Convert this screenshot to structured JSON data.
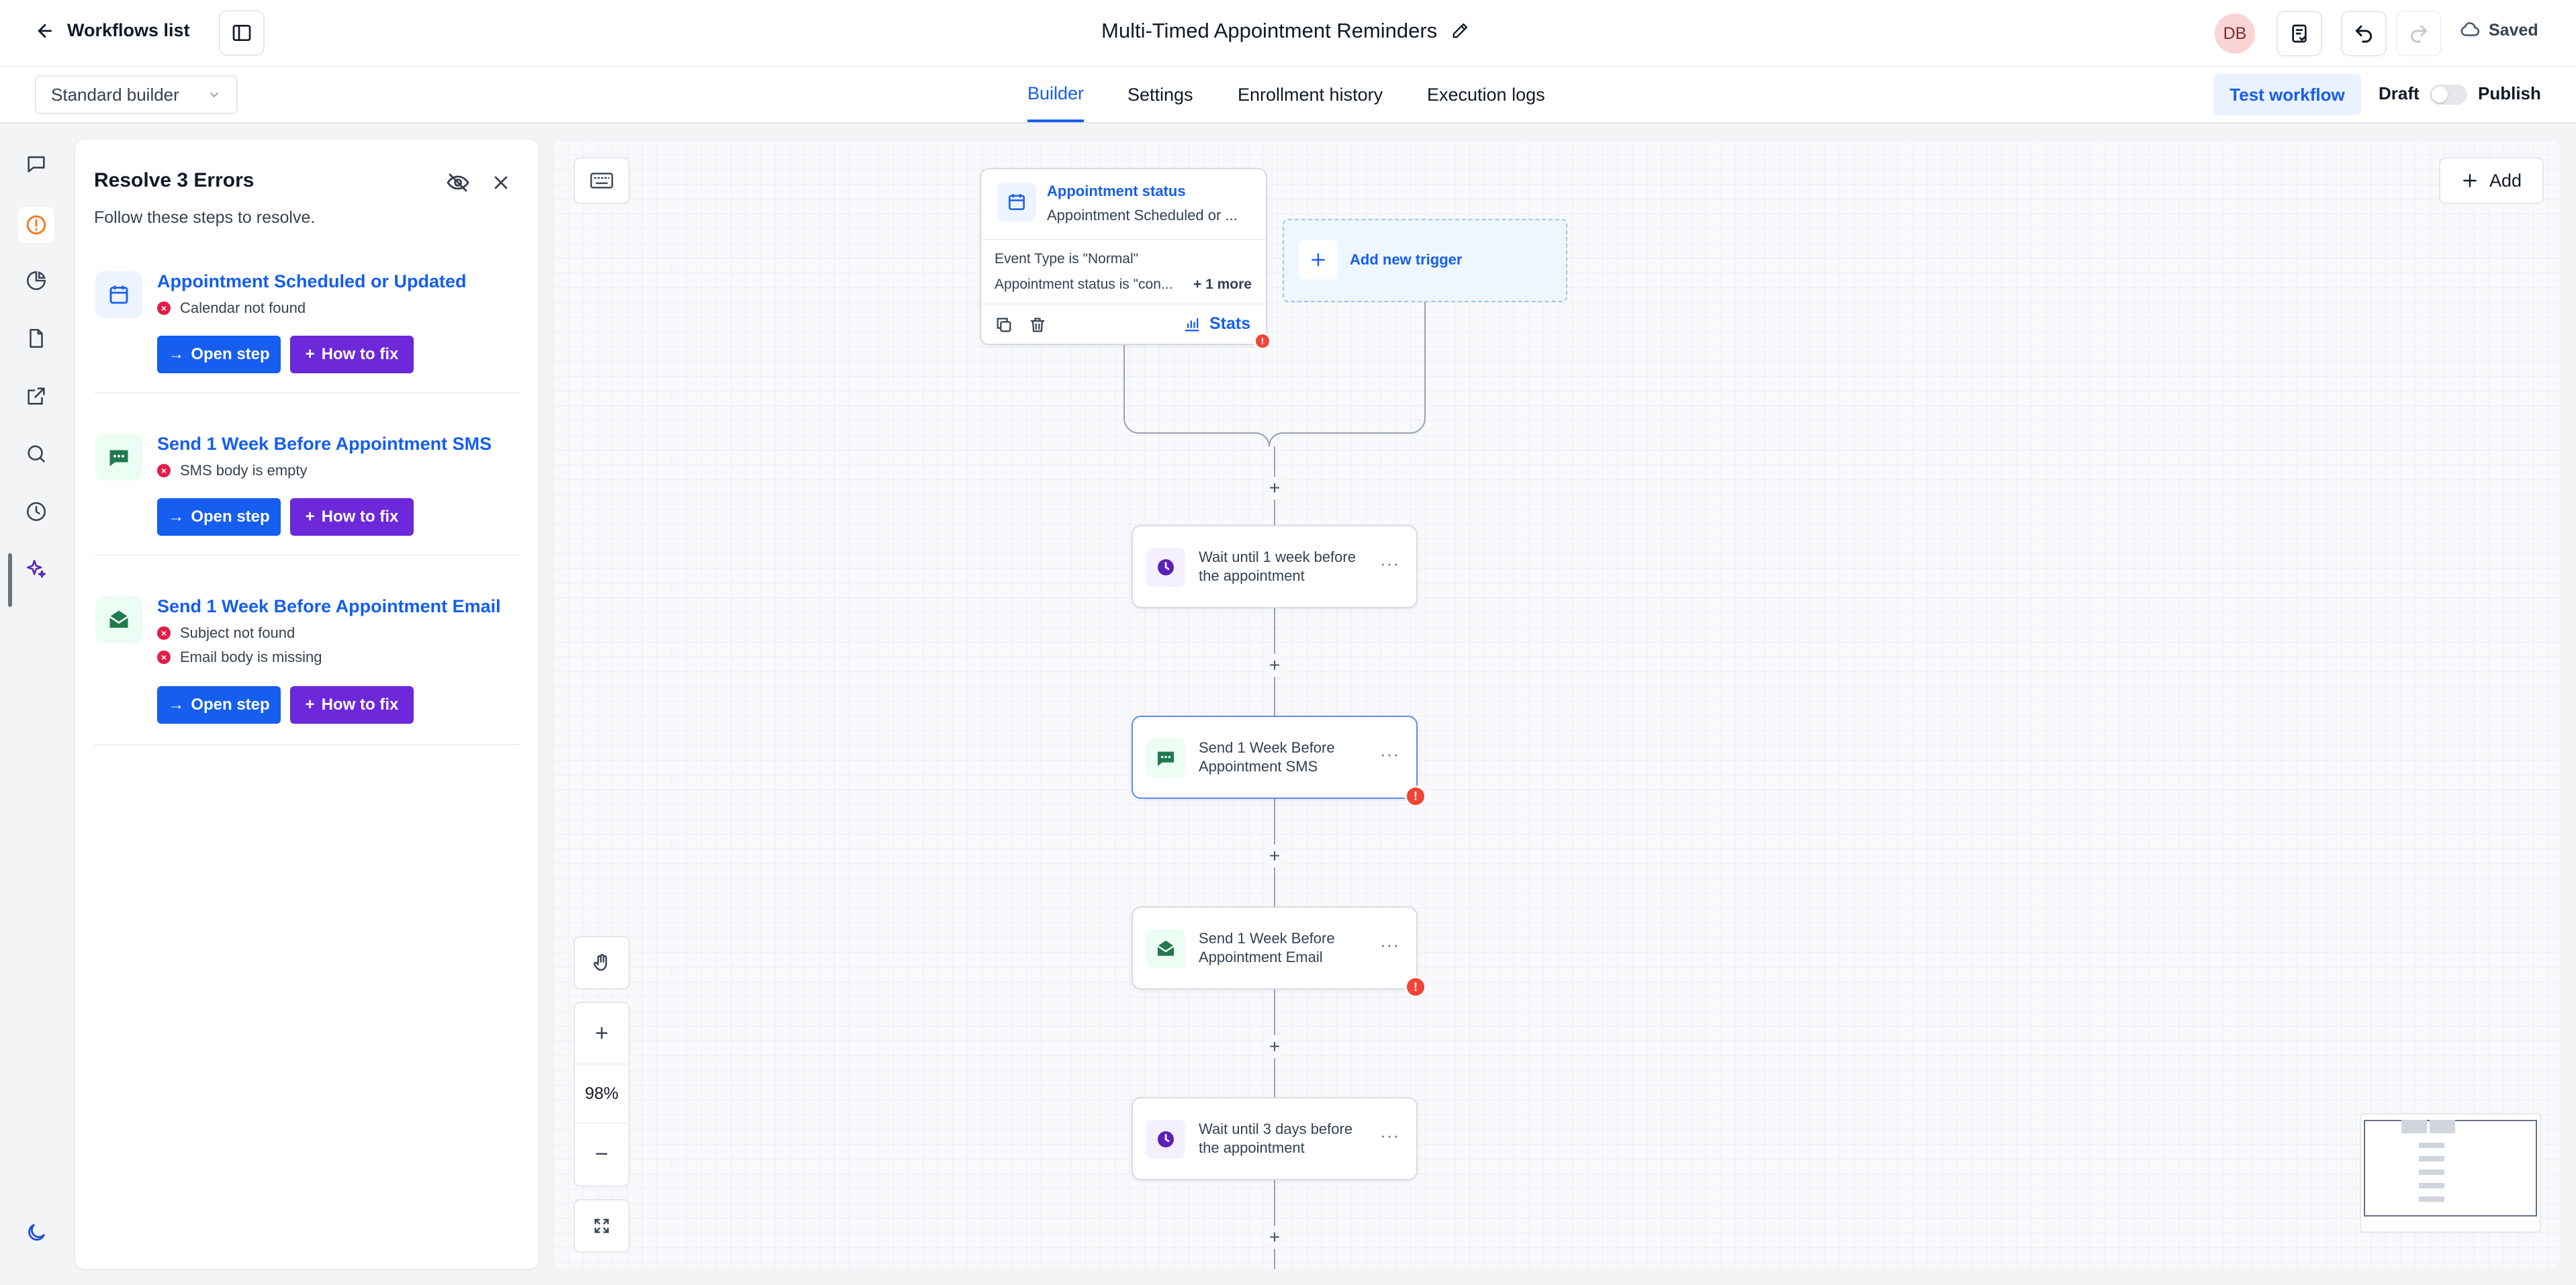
{
  "header": {
    "back_label": "Workflows list",
    "workflow_title": "Multi-Timed Appointment Reminders",
    "avatar_initials": "DB",
    "save_status": "Saved"
  },
  "subbar": {
    "builder_mode": "Standard builder",
    "tabs": [
      {
        "label": "Builder",
        "active": true
      },
      {
        "label": "Settings",
        "active": false
      },
      {
        "label": "Enrollment history",
        "active": false
      },
      {
        "label": "Execution logs",
        "active": false
      }
    ],
    "test_workflow_label": "Test workflow",
    "draft_label": "Draft",
    "publish_label": "Publish",
    "publish_toggle_on": false
  },
  "rail": {
    "icons": [
      "chat-icon",
      "alert-circle-icon",
      "pie-chart-icon",
      "file-icon",
      "external-link-icon",
      "search-icon",
      "history-icon",
      "sparkles-icon",
      "moon-icon"
    ]
  },
  "errors_panel": {
    "title": "Resolve 3 Errors",
    "subtitle": "Follow these steps to resolve.",
    "open_step_label": "Open step",
    "how_to_fix_label": "How to fix",
    "items": [
      {
        "title": "Appointment Scheduled or Updated",
        "icon": "calendar-icon",
        "messages": [
          "Calendar not found"
        ]
      },
      {
        "title": "Send 1 Week Before Appointment SMS",
        "icon": "sms-icon",
        "messages": [
          "SMS body is empty"
        ]
      },
      {
        "title": "Send 1 Week Before Appointment Email",
        "icon": "email-icon",
        "messages": [
          "Subject not found",
          "Email body is missing"
        ]
      }
    ]
  },
  "canvas": {
    "add_label": "Add",
    "zoom_level": "98%",
    "trigger": {
      "title": "Appointment status",
      "subtitle": "Appointment Scheduled or ...",
      "filters": [
        "Event Type is \"Normal\"",
        "Appointment status is \"con..."
      ],
      "more_label": "+ 1 more",
      "stats_label": "Stats"
    },
    "add_trigger_label": "Add new trigger",
    "steps": [
      {
        "label_line1": "Wait until 1 week before",
        "label_line2": "the appointment",
        "icon": "clock-icon",
        "has_error": false
      },
      {
        "label_line1": "Send 1 Week Before",
        "label_line2": "Appointment SMS",
        "icon": "sms-icon",
        "has_error": true
      },
      {
        "label_line1": "Send 1 Week Before",
        "label_line2": "Appointment Email",
        "icon": "email-icon",
        "has_error": true
      },
      {
        "label_line1": "Wait until 3 days before",
        "label_line2": "the appointment",
        "icon": "clock-icon",
        "has_error": false
      }
    ]
  },
  "colors": {
    "primary": "#155eef",
    "purple": "#6d28d9",
    "error": "#e11d48",
    "warning": "#f04438",
    "sms_green": "#1f7a4d"
  }
}
